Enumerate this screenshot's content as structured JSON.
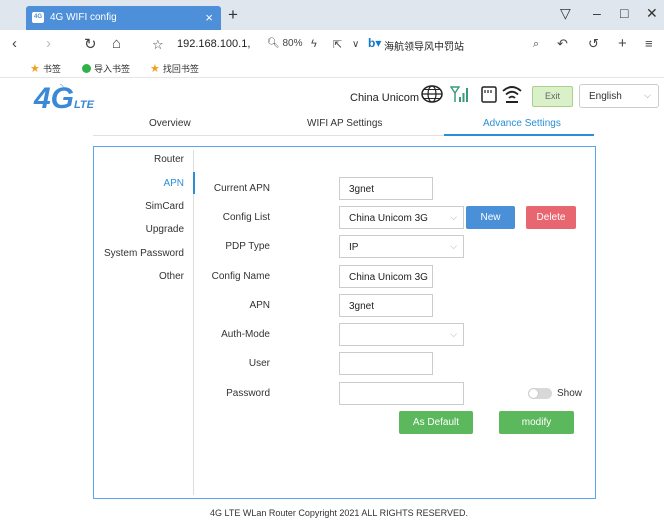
{
  "browser": {
    "tab_title": "4G WIFI config",
    "tab_close": "×",
    "new_tab": "+",
    "url": "192.168.100.1,",
    "zoom": "80%",
    "bing_link": "海航领导风中罚站",
    "bookmarks": [
      "书签",
      "导入书签",
      "找回书签"
    ]
  },
  "header": {
    "logo_main": "4G",
    "logo_sub": "LTE",
    "carrier": "China Unicom",
    "exit_label": "Exit",
    "language": "English"
  },
  "tabs": [
    {
      "label": "Overview",
      "active": false
    },
    {
      "label": "WIFI AP Settings",
      "active": false
    },
    {
      "label": "Advance Settings",
      "active": true
    }
  ],
  "sidebar": {
    "items": [
      {
        "label": "Router",
        "active": false
      },
      {
        "label": "APN",
        "active": true
      },
      {
        "label": "SimCard",
        "active": false
      },
      {
        "label": "Upgrade",
        "active": false
      },
      {
        "label": "System Password",
        "active": false
      },
      {
        "label": "Other",
        "active": false
      }
    ]
  },
  "form": {
    "current_apn_label": "Current APN",
    "current_apn_value": "3gnet",
    "config_list_label": "Config List",
    "config_list_value": "China Unicom 3G",
    "new_label": "New",
    "delete_label": "Delete",
    "pdp_type_label": "PDP Type",
    "pdp_type_value": "IP",
    "config_name_label": "Config Name",
    "config_name_value": "China Unicom 3G",
    "apn_label": "APN",
    "apn_value": "3gnet",
    "auth_mode_label": "Auth-Mode",
    "auth_mode_value": "",
    "user_label": "User",
    "user_value": "",
    "password_label": "Password",
    "password_value": "",
    "show_label": "Show",
    "as_default_label": "As Default",
    "modify_label": "modify"
  },
  "footer": "4G LTE WLan Router Copyright 2021 ALL RIGHTS RESERVED.",
  "colors": {
    "accent": "#2a8fd6",
    "new_button": "#4a90d9",
    "delete_button": "#e86670",
    "green_button": "#5cb85c"
  }
}
